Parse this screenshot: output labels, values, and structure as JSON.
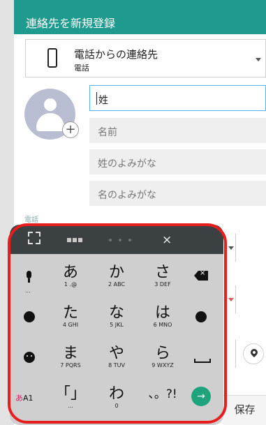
{
  "header": {
    "title": "連絡先を新規登録",
    "bg_color": "#1f9a8e"
  },
  "account": {
    "title": "電話からの連絡先",
    "subtitle": "電話"
  },
  "avatar": {
    "add_symbol": "+"
  },
  "fields": {
    "last_name": "姓",
    "first_name": "名前",
    "last_kana": "姓のよみがな",
    "first_kana": "名のよみがな"
  },
  "form": {
    "phone_label": "電話"
  },
  "keyboard": {
    "close_label": "×",
    "rows": [
      [
        {
          "main": "あ",
          "sub": "1 .@"
        },
        {
          "main": "か",
          "sub": "2 ABC"
        },
        {
          "main": "さ",
          "sub": "3 DEF"
        }
      ],
      [
        {
          "main": "た",
          "sub": "4 GHI"
        },
        {
          "main": "な",
          "sub": "5 JKL"
        },
        {
          "main": "は",
          "sub": "6 MNO"
        }
      ],
      [
        {
          "main": "ま",
          "sub": "7 PQRS"
        },
        {
          "main": "や",
          "sub": "8 TUV"
        },
        {
          "main": "ら",
          "sub": "9 WXYZ"
        }
      ],
      [
        {
          "main": "「」",
          "sub": ""
        },
        {
          "main": "わ",
          "sub": "0"
        },
        {
          "main": "、。?!",
          "sub": ""
        }
      ]
    ],
    "lang_label_a": "あ",
    "lang_label_b": "A1",
    "more_dots": "..."
  },
  "save_label": "保存",
  "colors": {
    "accent": "#1f9a8e",
    "highlight": "#e61e1e",
    "enter": "#1fa37d"
  }
}
